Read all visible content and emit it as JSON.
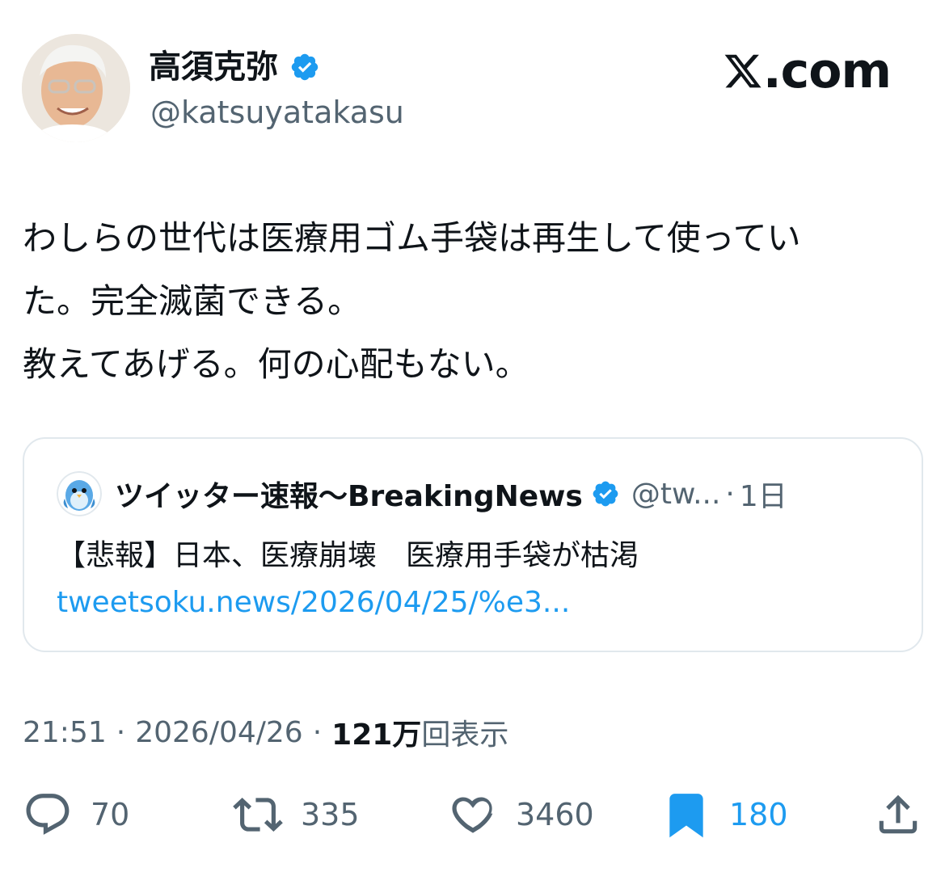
{
  "author": {
    "display_name": "高須克弥",
    "handle": "@katsuyatakasu",
    "verified": true
  },
  "brand": {
    "label": ".com"
  },
  "tweet": {
    "text": "わしらの世代は医療用ゴム手袋は再生して使ってい\nた。完全滅菌できる。\n教えてあげる。何の心配もない。"
  },
  "quote": {
    "display_name": "ツイッター速報〜BreakingNews",
    "handle": "@tw...",
    "separator": "·",
    "time": "1日",
    "text": "【悲報】日本、医療崩壊　医療用手袋が枯渇",
    "link": "tweetsoku.news/2026/04/25/%e3..."
  },
  "meta": {
    "time": "21:51",
    "dot1": "·",
    "date": "2026/04/26",
    "dot2": "·",
    "views_count": "121万",
    "views_label": "回表示"
  },
  "actions": {
    "reply_count": "70",
    "repost_count": "335",
    "like_count": "3460",
    "bookmark_count": "180"
  },
  "colors": {
    "accent": "#1d9bf0",
    "muted": "#536471",
    "text": "#0f1419"
  },
  "icons": [
    "verified-badge-icon",
    "x-logo-icon",
    "reply-icon",
    "repost-icon",
    "like-icon",
    "bookmark-icon",
    "share-icon"
  ]
}
